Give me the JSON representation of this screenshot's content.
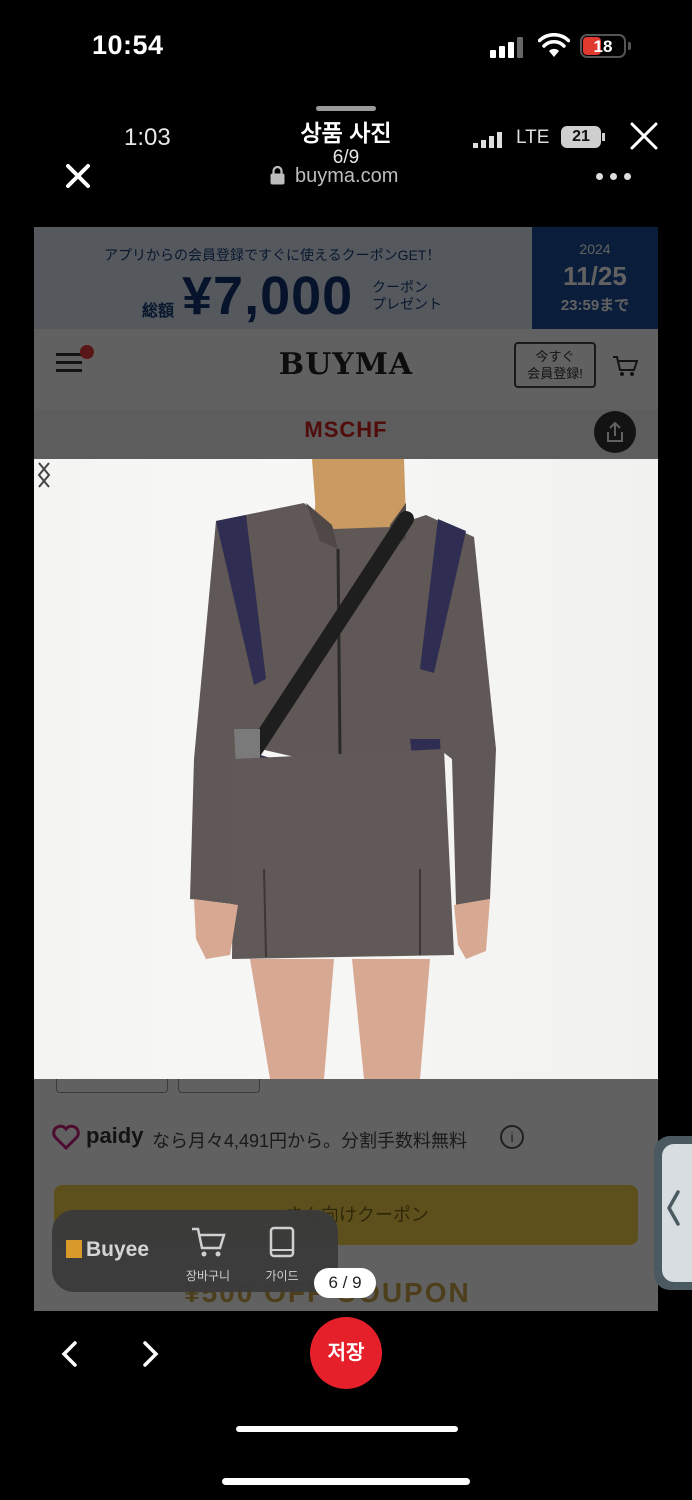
{
  "status_bar": {
    "time": "10:54",
    "battery": "18",
    "battery_color": "#e03a2f"
  },
  "viewer": {
    "inner_time": "1:03",
    "title": "상품 사진",
    "counter": "6/9",
    "network": "LTE",
    "inner_battery": "21",
    "url": "buyma.com",
    "page_indicator": "6 / 9",
    "save_label": "저장",
    "save_color": "#e5202a",
    "icons": [
      "close-icon",
      "lock-icon",
      "more-icon",
      "chevron-left-icon",
      "chevron-right-icon"
    ]
  },
  "promo": {
    "headline": "アプリからの会員登録ですぐに使えるクーポンGET！",
    "total_label": "総額",
    "amount": "¥7,000",
    "coupon_label_1": "クーポン",
    "coupon_label_2": "プレゼント",
    "date_year": "2024",
    "date": "11/25",
    "deadline": "23:59まで"
  },
  "site": {
    "logo": "BUYMA",
    "register_line1": "今すぐ",
    "register_line2": "会員登録!",
    "brand": "MSCHF"
  },
  "payment": {
    "provider": "paidy",
    "text": "なら月々4,491円から。分割手数料無料",
    "info": "i"
  },
  "coupon_button": {
    "label": "○○さん向けクーポン"
  },
  "coupon_strip": {
    "label": "¥500 OFF COUPON"
  },
  "buyee": {
    "logo": "Buyee",
    "cart_label": "장바구니",
    "guide_label": "가이드"
  }
}
